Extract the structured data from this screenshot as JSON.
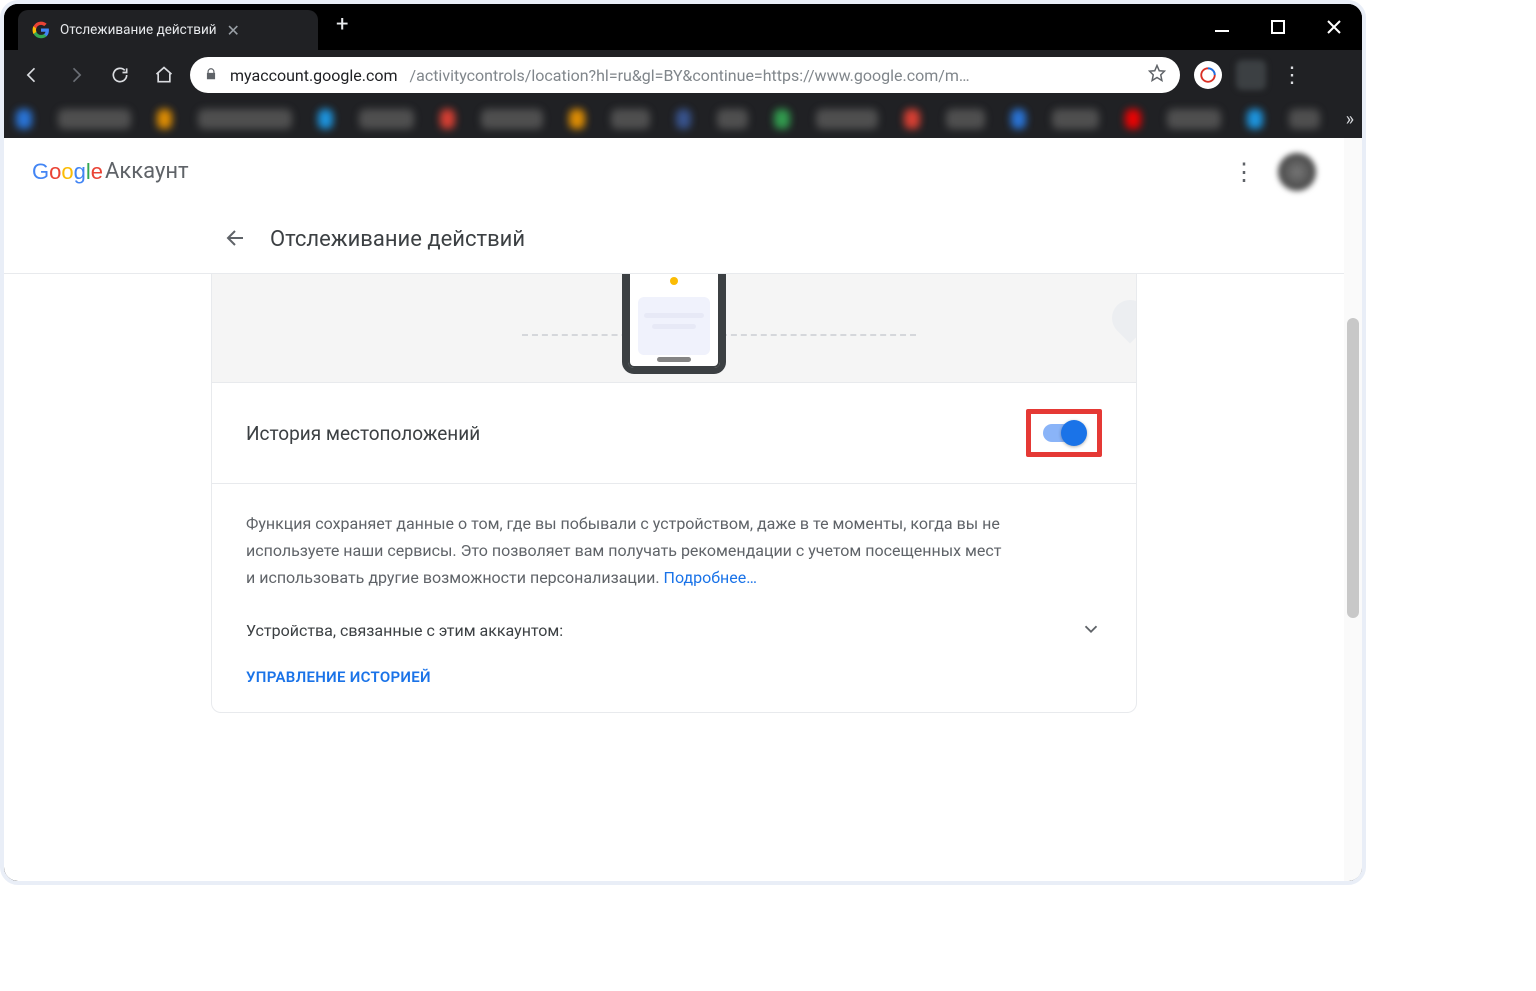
{
  "browser": {
    "tab_title": "Отслеживание действий",
    "url_host": "myaccount.google.com",
    "url_path": "/activitycontrols/location?hl=ru&gl=BY&continue=https://www.google.com/m…"
  },
  "header": {
    "product": "Аккаунт"
  },
  "subheader": {
    "title": "Отслеживание действий"
  },
  "card": {
    "toggle_label": "История местоположений",
    "toggle_on": true,
    "description": "Функция сохраняет данные о том, где вы побывали с устройством, даже в те моменты, когда вы не используете наши сервисы. Это позволяет вам получать рекомендации с учетом посещенных мест и использовать другие возможности персонализации. ",
    "learn_more": "Подробнее…",
    "devices_label": "Устройства, связанные с этим аккаунтом:",
    "manage_label": "УПРАВЛЕНИЕ ИСТОРИЕЙ"
  }
}
